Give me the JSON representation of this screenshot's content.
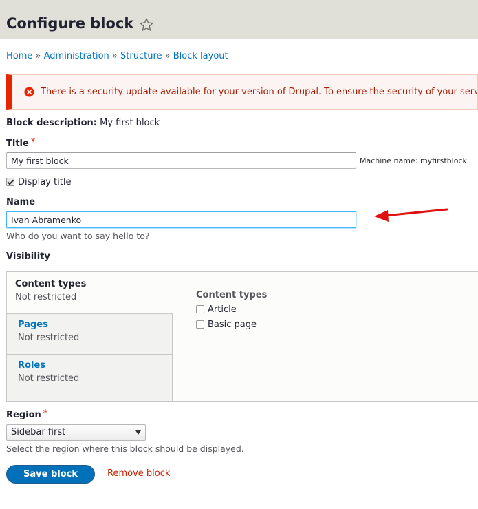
{
  "header": {
    "title": "Configure block",
    "star_icon": "star-outline-icon"
  },
  "breadcrumb": {
    "items": [
      "Home",
      "Administration",
      "Structure",
      "Block layout"
    ],
    "separator": "»"
  },
  "alert": {
    "icon": "error-circle-icon",
    "text": "There is a security update available for your version of Drupal. To ensure the security of your server, you should update immediately!",
    "color": "#e62600"
  },
  "form": {
    "block_description_label": "Block description:",
    "block_description_value": "My first block",
    "title_label": "Title",
    "required_mark": "*",
    "title_value": "My first block",
    "machine_name_label": "Machine name:",
    "machine_name_value": "myfirstblock",
    "display_title_label": "Display title",
    "display_title_checked": true,
    "name_label": "Name",
    "name_value": "Ivan Abramenko",
    "name_description": "Who do you want to say hello to?",
    "visibility_label": "Visibility"
  },
  "visibility": {
    "tabs": [
      {
        "title": "Content types",
        "summary": "Not restricted",
        "active": true
      },
      {
        "title": "Pages",
        "summary": "Not restricted",
        "active": false
      },
      {
        "title": "Roles",
        "summary": "Not restricted",
        "active": false
      }
    ],
    "pane": {
      "title": "Content types",
      "options": [
        {
          "label": "Article",
          "checked": false
        },
        {
          "label": "Basic page",
          "checked": false
        }
      ]
    }
  },
  "region": {
    "label": "Region",
    "selected": "Sidebar first",
    "description": "Select the region where this block should be displayed."
  },
  "actions": {
    "save_label": "Save block",
    "remove_label": "Remove block"
  },
  "colors": {
    "primary": "#0071b8",
    "link": "#0074bd",
    "danger": "#c72100",
    "annotation_arrow": "#e01010"
  }
}
